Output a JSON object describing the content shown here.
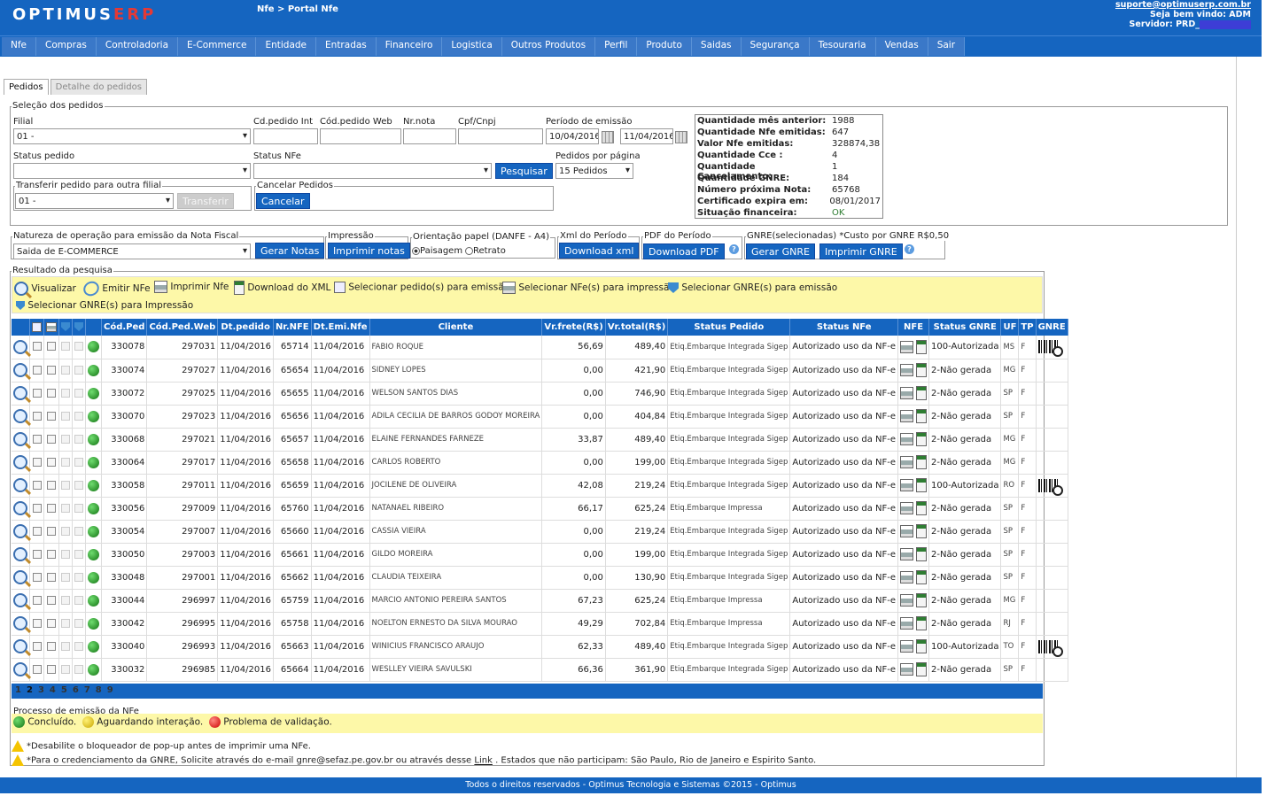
{
  "header": {
    "logo_text": "OPTIMUS",
    "logo_erp": "ERP",
    "breadcrumb": "Nfe > Portal Nfe",
    "support_email": "suporte@optimuserp.com.br",
    "welcome": "Seja bem vindo: ADM",
    "server": "Servidor: PRD_"
  },
  "menu": [
    "Nfe",
    "Compras",
    "Controladoria",
    "E-Commerce",
    "Entidade",
    "Entradas",
    "Financeiro",
    "Logistica",
    "Outros Produtos",
    "Perfil",
    "Produto",
    "Saidas",
    "Segurança",
    "Tesouraria",
    "Vendas",
    "Sair"
  ],
  "tabs": [
    "Pedidos",
    "Detalhe do pedidos"
  ],
  "selection": {
    "legend": "Seleção dos pedidos",
    "filial_label": "Filial",
    "filial_value": "01 -",
    "cd_pedido_int_label": "Cd.pedido Int",
    "cod_pedido_web_label": "Cód.pedido Web",
    "nr_nota_label": "Nr.nota",
    "cpf_label": "Cpf/Cnpj",
    "periodo_label": "Período de emissão",
    "date_from": "10/04/2016",
    "date_to": "11/04/2016",
    "status_pedido_label": "Status pedido",
    "status_nfe_label": "Status NFe",
    "pesquisar": "Pesquisar",
    "por_pagina_label": "Pedidos por página",
    "por_pagina_value": "15 Pedidos",
    "transferir_legend": "Transferir pedido para outra filial",
    "transferir_value": "01 -",
    "transferir_btn": "Transferir",
    "cancelar_legend": "Cancelar Pedidos",
    "cancelar_btn": "Cancelar"
  },
  "stats": [
    {
      "k": "Quantidade mês anterior:",
      "v": "1988"
    },
    {
      "k": "Quantidade Nfe emitidas:",
      "v": "647"
    },
    {
      "k": "Valor Nfe emitidas:",
      "v": "328874,38"
    },
    {
      "k": "Quantidade Cce :",
      "v": "4"
    },
    {
      "k": "Quantidade Cancelamento:",
      "v": "1"
    },
    {
      "k": "Quantidade GNRE:",
      "v": "184"
    },
    {
      "k": "Número próxima Nota:",
      "v": "65768"
    },
    {
      "k": "Certificado expira em:",
      "v": "08/01/2017"
    },
    {
      "k": "Situação financeira:",
      "v": "OK"
    }
  ],
  "actions": {
    "natureza_legend": "Natureza de operação para emissão da Nota Fiscal",
    "natureza_value": "Saida de E-COMMERCE",
    "gerar_notas": "Gerar Notas",
    "impressao_legend": "Impressão",
    "imprimir_notas": "Imprimir notas",
    "orientacao_legend": "Orientação papel (DANFE - A4)",
    "paisagem": "Paisagem",
    "retrato": "Retrato",
    "xml_legend": "Xml do Período",
    "download_xml": "Download xml",
    "pdf_legend": "PDF do Período",
    "download_pdf": "Download PDF",
    "gnre_legend": "GNRE(selecionadas) *Custo por GNRE R$0,50",
    "gerar_gnre": "Gerar GNRE",
    "imprimir_gnre": "Imprimir GNRE"
  },
  "results": {
    "legend": "Resultado da pesquisa",
    "tool_visualizar": "Visualizar",
    "tool_emitir": "Emitir NFe",
    "tool_imprimir": "Imprimir Nfe",
    "tool_download": "Download do XML",
    "tool_sel_pedido": "Selecionar pedido(s) para emissão",
    "tool_sel_nfe": "Selecionar NFe(s) para impressão",
    "tool_sel_gnre": "Selecionar GNRE(s) para emissão",
    "tool_sel_gnre_imp": "Selecionar GNRE(s) para Impressão"
  },
  "columns": [
    "Cód.Ped",
    "Cód.Ped.Web",
    "Dt.pedido",
    "Nr.NFE",
    "Dt.Emi.Nfe",
    "Cliente",
    "Vr.frete(R$)",
    "Vr.total(R$)",
    "Status Pedido",
    "Status NFe",
    "NFE",
    "Status GNRE",
    "UF",
    "TP",
    "GNRE"
  ],
  "rows": [
    {
      "cod": "330078",
      "web": "297031",
      "dt": "11/04/2016",
      "nfe": "65714",
      "dte": "11/04/2016",
      "cli": "FABIO ROQUE",
      "frete": "56,69",
      "total": "489,40",
      "sp": "Etiq.Embarque Integrada Sigep",
      "sn": "Autorizado uso da NF-e",
      "sg": "100-Autorizada",
      "uf": "MS",
      "tp": "F",
      "gnre": true
    },
    {
      "cod": "330074",
      "web": "297027",
      "dt": "11/04/2016",
      "nfe": "65654",
      "dte": "11/04/2016",
      "cli": "SIDNEY LOPES",
      "frete": "0,00",
      "total": "421,90",
      "sp": "Etiq.Embarque Integrada Sigep",
      "sn": "Autorizado uso da NF-e",
      "sg": "2-Não gerada",
      "uf": "MG",
      "tp": "F",
      "gnre": false
    },
    {
      "cod": "330072",
      "web": "297025",
      "dt": "11/04/2016",
      "nfe": "65655",
      "dte": "11/04/2016",
      "cli": "WELSON SANTOS DIAS",
      "frete": "0,00",
      "total": "746,90",
      "sp": "Etiq.Embarque Integrada Sigep",
      "sn": "Autorizado uso da NF-e",
      "sg": "2-Não gerada",
      "uf": "SP",
      "tp": "F",
      "gnre": false
    },
    {
      "cod": "330070",
      "web": "297023",
      "dt": "11/04/2016",
      "nfe": "65656",
      "dte": "11/04/2016",
      "cli": "ADILA CECILIA DE BARROS GODOY MOREIRA",
      "frete": "0,00",
      "total": "404,84",
      "sp": "Etiq.Embarque Integrada Sigep",
      "sn": "Autorizado uso da NF-e",
      "sg": "2-Não gerada",
      "uf": "SP",
      "tp": "F",
      "gnre": false
    },
    {
      "cod": "330068",
      "web": "297021",
      "dt": "11/04/2016",
      "nfe": "65657",
      "dte": "11/04/2016",
      "cli": "ELAINE FERNANDES FARNEZE",
      "frete": "33,87",
      "total": "489,40",
      "sp": "Etiq.Embarque Integrada Sigep",
      "sn": "Autorizado uso da NF-e",
      "sg": "2-Não gerada",
      "uf": "MG",
      "tp": "F",
      "gnre": false
    },
    {
      "cod": "330064",
      "web": "297017",
      "dt": "11/04/2016",
      "nfe": "65658",
      "dte": "11/04/2016",
      "cli": "CARLOS ROBERTO",
      "frete": "0,00",
      "total": "199,00",
      "sp": "Etiq.Embarque Integrada Sigep",
      "sn": "Autorizado uso da NF-e",
      "sg": "2-Não gerada",
      "uf": "MG",
      "tp": "F",
      "gnre": false
    },
    {
      "cod": "330058",
      "web": "297011",
      "dt": "11/04/2016",
      "nfe": "65659",
      "dte": "11/04/2016",
      "cli": "JOCILENE DE OLIVEIRA",
      "frete": "42,08",
      "total": "219,24",
      "sp": "Etiq.Embarque Integrada Sigep",
      "sn": "Autorizado uso da NF-e",
      "sg": "100-Autorizada",
      "uf": "RO",
      "tp": "F",
      "gnre": true
    },
    {
      "cod": "330056",
      "web": "297009",
      "dt": "11/04/2016",
      "nfe": "65760",
      "dte": "11/04/2016",
      "cli": "NATANAEL RIBEIRO",
      "frete": "66,17",
      "total": "625,24",
      "sp": "Etiq.Embarque Impressa",
      "sn": "Autorizado uso da NF-e",
      "sg": "2-Não gerada",
      "uf": "SP",
      "tp": "F",
      "gnre": false
    },
    {
      "cod": "330054",
      "web": "297007",
      "dt": "11/04/2016",
      "nfe": "65660",
      "dte": "11/04/2016",
      "cli": "CASSIA VIEIRA",
      "frete": "0,00",
      "total": "219,24",
      "sp": "Etiq.Embarque Integrada Sigep",
      "sn": "Autorizado uso da NF-e",
      "sg": "2-Não gerada",
      "uf": "SP",
      "tp": "F",
      "gnre": false
    },
    {
      "cod": "330050",
      "web": "297003",
      "dt": "11/04/2016",
      "nfe": "65661",
      "dte": "11/04/2016",
      "cli": "GILDO MOREIRA",
      "frete": "0,00",
      "total": "199,00",
      "sp": "Etiq.Embarque Integrada Sigep",
      "sn": "Autorizado uso da NF-e",
      "sg": "2-Não gerada",
      "uf": "SP",
      "tp": "F",
      "gnre": false
    },
    {
      "cod": "330048",
      "web": "297001",
      "dt": "11/04/2016",
      "nfe": "65662",
      "dte": "11/04/2016",
      "cli": "CLAUDIA TEIXEIRA",
      "frete": "0,00",
      "total": "130,90",
      "sp": "Etiq.Embarque Integrada Sigep",
      "sn": "Autorizado uso da NF-e",
      "sg": "2-Não gerada",
      "uf": "SP",
      "tp": "F",
      "gnre": false
    },
    {
      "cod": "330044",
      "web": "296997",
      "dt": "11/04/2016",
      "nfe": "65759",
      "dte": "11/04/2016",
      "cli": "MARCIO ANTONIO PEREIRA SANTOS",
      "frete": "67,23",
      "total": "625,24",
      "sp": "Etiq.Embarque Impressa",
      "sn": "Autorizado uso da NF-e",
      "sg": "2-Não gerada",
      "uf": "MG",
      "tp": "F",
      "gnre": false
    },
    {
      "cod": "330042",
      "web": "296995",
      "dt": "11/04/2016",
      "nfe": "65758",
      "dte": "11/04/2016",
      "cli": "NOELTON ERNESTO DA SILVA MOURAO",
      "frete": "49,29",
      "total": "702,84",
      "sp": "Etiq.Embarque Impressa",
      "sn": "Autorizado uso da NF-e",
      "sg": "2-Não gerada",
      "uf": "RJ",
      "tp": "F",
      "gnre": false
    },
    {
      "cod": "330040",
      "web": "296993",
      "dt": "11/04/2016",
      "nfe": "65663",
      "dte": "11/04/2016",
      "cli": "WINICIUS FRANCISCO ARAUJO",
      "frete": "62,33",
      "total": "489,40",
      "sp": "Etiq.Embarque Integrada Sigep",
      "sn": "Autorizado uso da NF-e",
      "sg": "100-Autorizada",
      "uf": "TO",
      "tp": "F",
      "gnre": true
    },
    {
      "cod": "330032",
      "web": "296985",
      "dt": "11/04/2016",
      "nfe": "65664",
      "dte": "11/04/2016",
      "cli": "WESLLEY VIEIRA SAVULSKI",
      "frete": "66,36",
      "total": "361,90",
      "sp": "Etiq.Embarque Integrada Sigep",
      "sn": "Autorizado uso da NF-e",
      "sg": "2-Não gerada",
      "uf": "SP",
      "tp": "F",
      "gnre": false
    }
  ],
  "pager": {
    "current": "2",
    "pages": [
      "1",
      "2",
      "3",
      "4",
      "5",
      "6",
      "7",
      "8",
      "9"
    ]
  },
  "process": {
    "legend": "Processo de emissão da NFe",
    "concluido": "Concluído.",
    "aguardando": "Aguardando interação.",
    "problema": "Problema de validação."
  },
  "notes": {
    "popup": "*Desabilite o bloqueador de pop-up antes de imprimir uma NFe.",
    "gnre_before": "*Para o credenciamento da GNRE, Solicite através do e-mail gnre@sefaz.pe.gov.br ou através desse",
    "gnre_link": "Link",
    "gnre_after": ". Estados que não participam: São Paulo, Rio de Janeiro e Espirito Santo."
  },
  "footer": "Todos o direitos reservados - Optimus Tecnologia e Sistemas ©2015 - Optimus"
}
